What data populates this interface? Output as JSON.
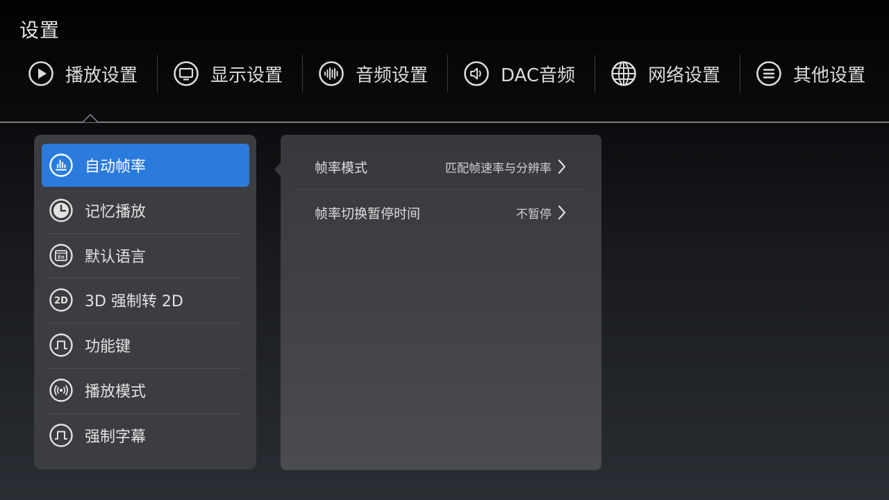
{
  "page": {
    "title": "设置"
  },
  "tabs": [
    {
      "label": "播放设置",
      "icon": "play-circle-icon",
      "active": true
    },
    {
      "label": "显示设置",
      "icon": "monitor-icon"
    },
    {
      "label": "音频设置",
      "icon": "audio-wave-icon"
    },
    {
      "label": "DAC音频",
      "icon": "speaker-icon"
    },
    {
      "label": "网络设置",
      "icon": "globe-icon"
    },
    {
      "label": "其他设置",
      "icon": "menu-lines-icon"
    }
  ],
  "menu": [
    {
      "label": "自动帧率",
      "icon": "bar-chart-icon",
      "active": true
    },
    {
      "label": "记忆播放",
      "icon": "clock-icon"
    },
    {
      "label": "默认语言",
      "icon": "language-en-icon"
    },
    {
      "label": "3D 强制转 2D",
      "icon": "2d-icon"
    },
    {
      "label": "功能键",
      "icon": "pulse-icon"
    },
    {
      "label": "播放模式",
      "icon": "broadcast-icon"
    },
    {
      "label": "强制字幕",
      "icon": "pulse-icon"
    }
  ],
  "settings": [
    {
      "label": "帧率模式",
      "value": "匹配帧速率与分辨率"
    },
    {
      "label": "帧率切换暂停时间",
      "value": "不暂停"
    }
  ],
  "colors": {
    "accent": "#2b7bdd",
    "panel": "#3b3d41"
  }
}
